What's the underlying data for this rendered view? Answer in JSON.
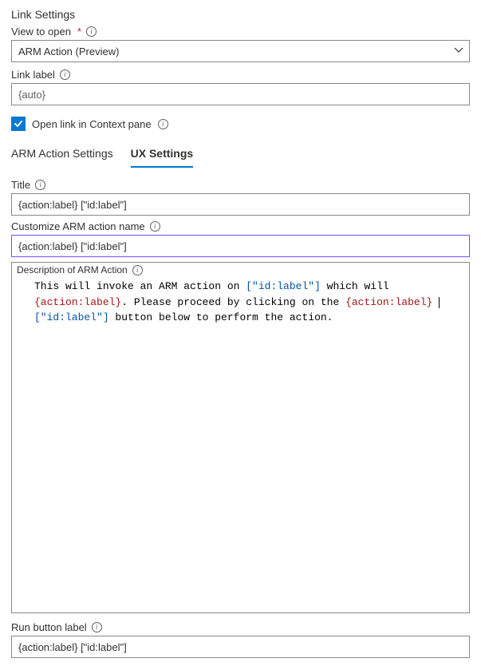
{
  "header": {
    "title": "Link Settings"
  },
  "viewToOpen": {
    "label": "View to open",
    "value": "ARM Action (Preview)"
  },
  "linkLabel": {
    "label": "Link label",
    "value": "{auto}"
  },
  "openInContext": {
    "label": "Open link in Context pane",
    "checked": true
  },
  "tabs": {
    "items": [
      {
        "label": "ARM Action Settings",
        "active": false
      },
      {
        "label": "UX Settings",
        "active": true
      }
    ]
  },
  "title": {
    "label": "Title",
    "value": "{action:label} [\"id:label\"]"
  },
  "customizeName": {
    "label": "Customize ARM action name",
    "value": "{action:label} [\"id:label\"]"
  },
  "description": {
    "label": "Description of ARM Action",
    "tokens": [
      {
        "t": "plain",
        "v": "This will invoke an ARM action on "
      },
      {
        "t": "bracket",
        "v": "[\"id:label\"]"
      },
      {
        "t": "plain",
        "v": " which will "
      },
      {
        "t": "brace",
        "v": "{action:label}"
      },
      {
        "t": "plain",
        "v": ". Please proceed by clicking on the "
      },
      {
        "t": "brace",
        "v": "{action:label}"
      },
      {
        "t": "plain",
        "v": " "
      },
      {
        "t": "cursor",
        "v": ""
      },
      {
        "t": "bracket",
        "v": "[\"id:label\"]"
      },
      {
        "t": "plain",
        "v": " button below to perform the action."
      }
    ]
  },
  "runButton": {
    "label": "Run button label",
    "value": "{action:label} [\"id:label\"]"
  }
}
